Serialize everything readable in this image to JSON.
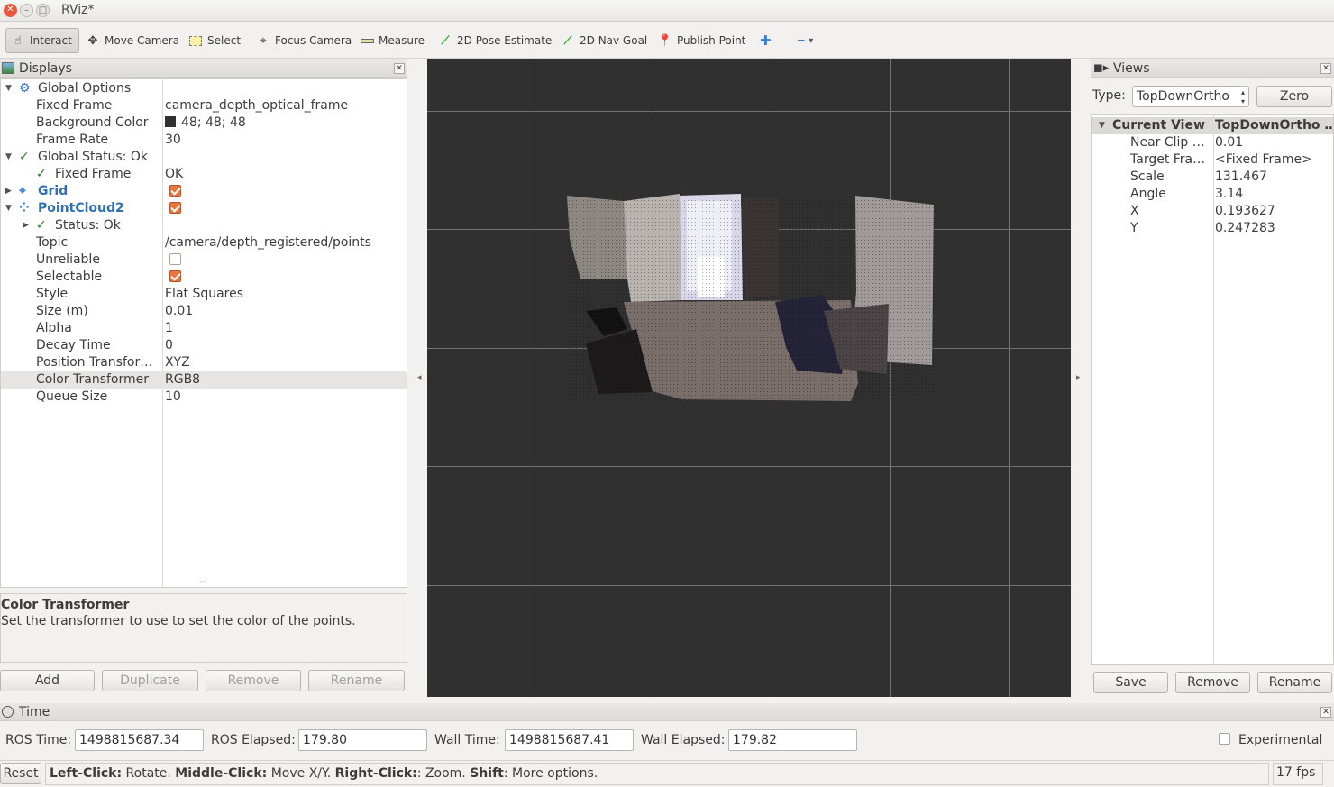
{
  "window": {
    "title": "RViz*"
  },
  "toolbar": {
    "tools": [
      {
        "label": "Interact",
        "icon": "hand-icon"
      },
      {
        "label": "Move Camera",
        "icon": "move-camera-icon"
      },
      {
        "label": "Select",
        "icon": "select-icon"
      },
      {
        "label": "Focus Camera",
        "icon": "focus-camera-icon"
      },
      {
        "label": "Measure",
        "icon": "ruler-icon"
      },
      {
        "label": "2D Pose Estimate",
        "icon": "pose-arrow-icon"
      },
      {
        "label": "2D Nav Goal",
        "icon": "nav-goal-arrow-icon"
      },
      {
        "label": "Publish Point",
        "icon": "map-pin-icon"
      }
    ],
    "add_symbol": "✚",
    "remove_symbol": "━",
    "dropdown_symbol": "▾"
  },
  "displays": {
    "title": "Displays",
    "rows": [
      {
        "name": "Global Options",
        "value": ""
      },
      {
        "name": "Fixed Frame",
        "value": "camera_depth_optical_frame"
      },
      {
        "name": "Background Color",
        "value": "48; 48; 48"
      },
      {
        "name": "Frame Rate",
        "value": "30"
      },
      {
        "name": "Global Status: Ok",
        "value": ""
      },
      {
        "name": "Fixed Frame",
        "value": "OK"
      },
      {
        "name": "Grid",
        "value": ""
      },
      {
        "name": "PointCloud2",
        "value": ""
      },
      {
        "name": "Status: Ok",
        "value": ""
      },
      {
        "name": "Topic",
        "value": "/camera/depth_registered/points"
      },
      {
        "name": "Unreliable",
        "value": ""
      },
      {
        "name": "Selectable",
        "value": ""
      },
      {
        "name": "Style",
        "value": "Flat Squares"
      },
      {
        "name": "Size (m)",
        "value": "0.01"
      },
      {
        "name": "Alpha",
        "value": "1"
      },
      {
        "name": "Decay Time",
        "value": "0"
      },
      {
        "name": "Position Transfor…",
        "value": "XYZ"
      },
      {
        "name": "Color Transformer",
        "value": "RGB8"
      },
      {
        "name": "Queue Size",
        "value": "10"
      }
    ],
    "background_color_hex": "#303030",
    "desc_title": "Color Transformer",
    "desc_text": "Set the transformer to use to set the color of the points.",
    "buttons": {
      "add": "Add",
      "duplicate": "Duplicate",
      "remove": "Remove",
      "rename": "Rename"
    }
  },
  "views": {
    "title": "Views",
    "type_label": "Type:",
    "type_value": "TopDownOrtho",
    "zero": "Zero",
    "header_name": "Current View",
    "header_value": "TopDownOrtho …",
    "rows": [
      {
        "name": "Near Clip …",
        "value": "0.01"
      },
      {
        "name": "Target Fra…",
        "value": "<Fixed Frame>"
      },
      {
        "name": "Scale",
        "value": "131.467"
      },
      {
        "name": "Angle",
        "value": "3.14"
      },
      {
        "name": "X",
        "value": "0.193627"
      },
      {
        "name": "Y",
        "value": "0.247283"
      }
    ],
    "buttons": {
      "save": "Save",
      "remove": "Remove",
      "rename": "Rename"
    }
  },
  "time": {
    "title": "Time",
    "ros_time_label": "ROS Time:",
    "ros_time": "1498815687.34",
    "ros_elapsed_label": "ROS Elapsed:",
    "ros_elapsed": "179.80",
    "wall_time_label": "Wall Time:",
    "wall_time": "1498815687.41",
    "wall_elapsed_label": "Wall Elapsed:",
    "wall_elapsed": "179.82",
    "experimental": "Experimental"
  },
  "status": {
    "reset": "Reset",
    "k1": "Left-Click:",
    "t1": " Rotate. ",
    "k2": "Middle-Click:",
    "t2": " Move X/Y. ",
    "k3": "Right-Click:",
    "t3": ": Zoom. ",
    "k4": "Shift",
    "t4": ": More options.",
    "fps": "17 fps"
  }
}
